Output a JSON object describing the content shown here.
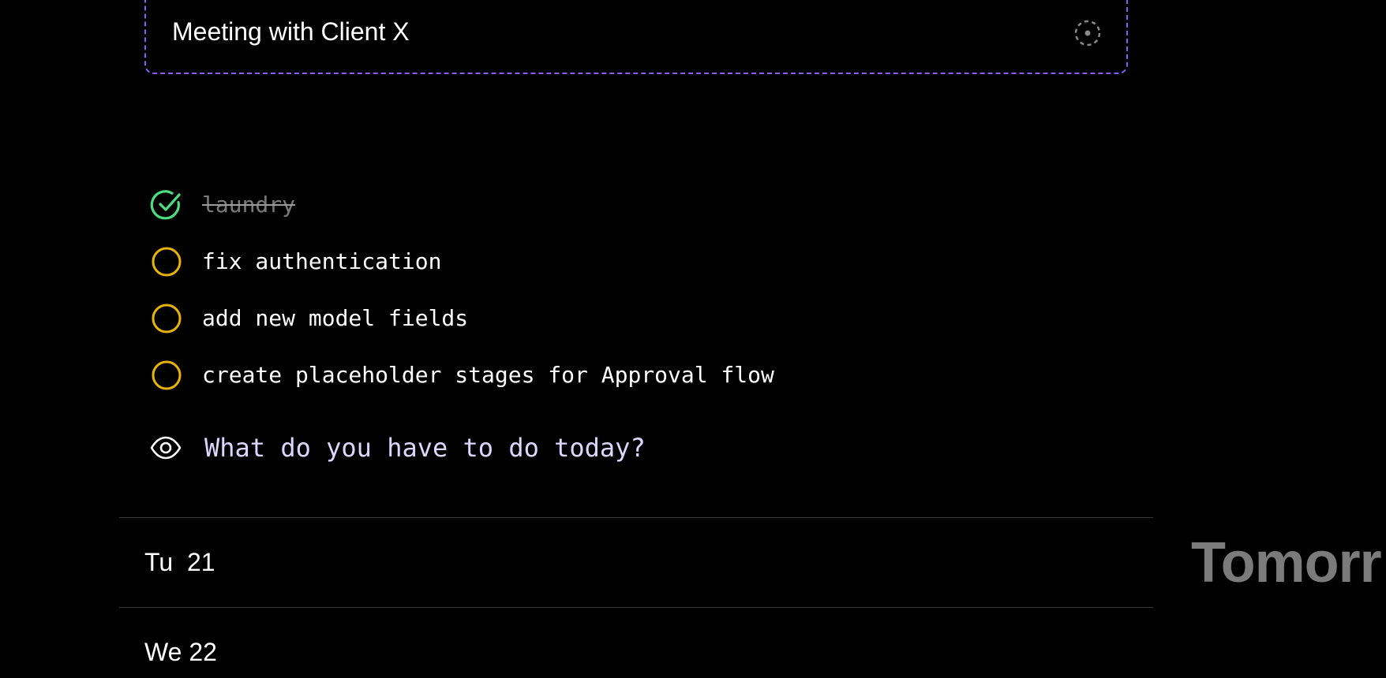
{
  "event": {
    "title": "Meeting with Client X",
    "icon": "dashed-circle-dot-icon",
    "border_color": "#8b5cf6"
  },
  "tasks": [
    {
      "text": "laundry",
      "done": true,
      "icon": "check-circle-icon",
      "color": "#4ade80"
    },
    {
      "text": "fix authentication",
      "done": false,
      "icon": "empty-circle-icon",
      "color": "#eab308"
    },
    {
      "text": "add new model fields",
      "done": false,
      "icon": "empty-circle-icon",
      "color": "#eab308"
    },
    {
      "text": "create placeholder stages for Approval flow",
      "done": false,
      "icon": "empty-circle-icon",
      "color": "#eab308"
    }
  ],
  "new_task": {
    "placeholder": "What do you have to do today?",
    "icon": "eye-icon",
    "color": "#ddd6fe"
  },
  "days": [
    {
      "label": "Tu  21"
    },
    {
      "label": "We 22"
    }
  ],
  "side_heading": "Tomorr"
}
